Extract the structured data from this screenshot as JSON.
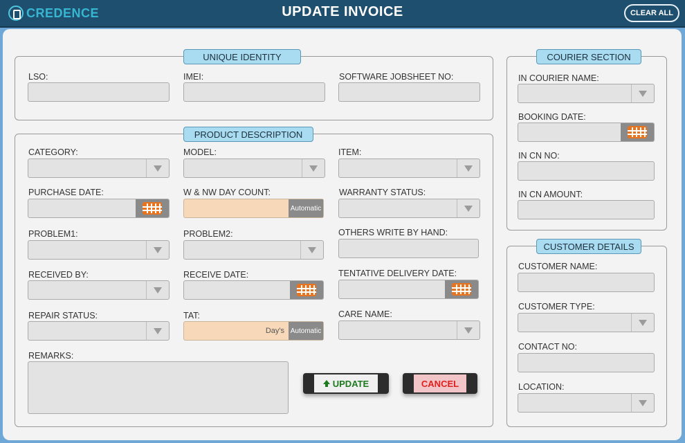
{
  "app": {
    "logo_text": "CREDENCE",
    "title": "UPDATE INVOICE",
    "clear_all": "CLEAR ALL"
  },
  "unique_identity": {
    "legend": "UNIQUE IDENTITY",
    "lso": "LSO:",
    "imei": "IMEI:",
    "software_jobsheet_no": "SOFTWARE JOBSHEET NO:"
  },
  "product_description": {
    "legend": "PRODUCT DESCRIPTION",
    "category": "CATEGORY:",
    "model": "MODEL:",
    "item": "ITEM:",
    "purchase_date": "PURCHASE DATE:",
    "w_nw_day_count": "W & NW DAY COUNT:",
    "warranty_status": "WARRANTY STATUS:",
    "problem1": "PROBLEM1:",
    "problem2": "PROBLEM2:",
    "others_write_by_hand": "OTHERS WRITE  BY  HAND:",
    "received_by": "RECEIVED BY:",
    "receive_date": "RECEIVE DATE:",
    "tentative_delivery_date": "TENTATIVE DELIVERY DATE:",
    "repair_status": "REPAIR STATUS:",
    "tat": "TAT:",
    "care_name": "CARE NAME:",
    "remarks": "REMARKS:",
    "automatic_tag": "Automatic",
    "days_unit": "Day's"
  },
  "buttons": {
    "update": "UPDATE",
    "cancel": "CANCEL"
  },
  "courier_section": {
    "legend": "COURIER SECTION",
    "in_courier_name": "IN COURIER NAME:",
    "booking_date": "BOOKING DATE:",
    "in_cn_no": "IN CN NO:",
    "in_cn_amount": "IN CN AMOUNT:"
  },
  "customer_details": {
    "legend": "CUSTOMER DETAILS",
    "customer_name": "CUSTOMER NAME:",
    "customer_type": "CUSTOMER TYPE:",
    "contact_no": "CONTACT NO:",
    "location": "LOCATION:"
  },
  "colors": {
    "title_bar": "#1f4f6e",
    "background": "#6fa8d6",
    "legend_fill": "#a9dcf1",
    "automatic_field": "#f7d9b9",
    "calendar_icon": "#e8741f",
    "update_text": "#1e7a1e",
    "cancel_text": "#e0201e"
  }
}
